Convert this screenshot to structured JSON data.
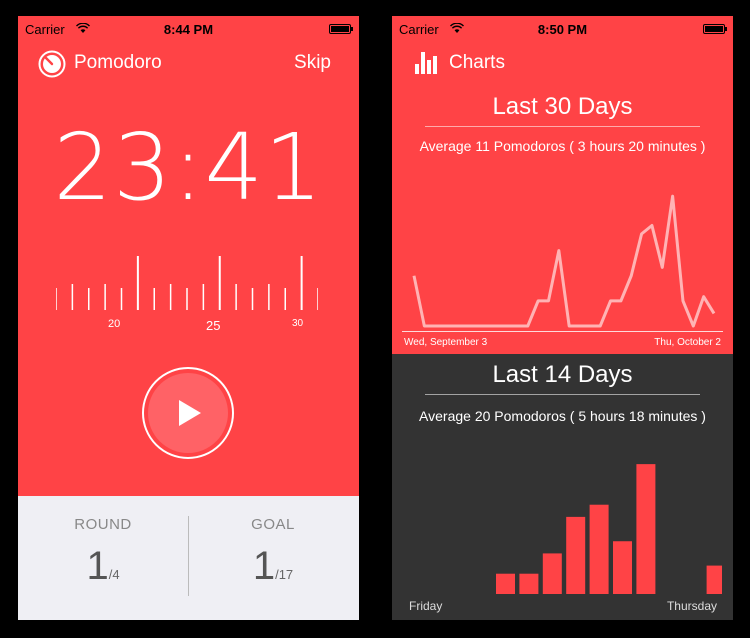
{
  "left": {
    "status": {
      "carrier": "Carrier",
      "time": "8:44 PM"
    },
    "nav": {
      "title": "Pomodoro",
      "skip_label": "Skip"
    },
    "timer": {
      "display": "23:41"
    },
    "ruler": {
      "labels": [
        "20",
        "25",
        "30"
      ],
      "ticks_visible": 17
    },
    "round": {
      "label": "ROUND",
      "value": "1",
      "total": "/4"
    },
    "goal": {
      "label": "GOAL",
      "value": "1",
      "total": "/17"
    },
    "colors": {
      "accent": "#ff4346",
      "bottom": "#efeff4"
    }
  },
  "right": {
    "status": {
      "carrier": "Carrier",
      "time": "8:50 PM"
    },
    "nav": {
      "title": "Charts"
    },
    "last30": {
      "title": "Last 30 Days",
      "subtitle": "Average 11 Pomodoros ( 3 hours 20 minutes )",
      "start_label": "Wed, September 3",
      "end_label": "Thu, October 2"
    },
    "last14": {
      "title": "Last 14 Days",
      "subtitle": "Average 20 Pomodoros ( 5 hours 18 minutes )",
      "start_label": "Friday",
      "end_label": "Thursday"
    },
    "colors": {
      "accent": "#ff4346",
      "dark": "#333333"
    }
  },
  "chart_data": [
    {
      "type": "line",
      "title": "Last 30 Days",
      "x": [
        1,
        2,
        3,
        4,
        5,
        6,
        7,
        8,
        9,
        10,
        11,
        12,
        13,
        14,
        15,
        16,
        17,
        18,
        19,
        20,
        21,
        22,
        23,
        24,
        25,
        26,
        27,
        28,
        29,
        30
      ],
      "series": [
        {
          "values": [
            12,
            0,
            0,
            0,
            0,
            0,
            0,
            0,
            0,
            0,
            0,
            0,
            6,
            6,
            18,
            0,
            0,
            0,
            0,
            6,
            6,
            12,
            22,
            24,
            14,
            31,
            6,
            0,
            7,
            3
          ]
        }
      ],
      "ylim": [
        0,
        32
      ]
    },
    {
      "type": "bar",
      "title": "Last 14 Days",
      "categories": [
        "1",
        "2",
        "3",
        "4",
        "5",
        "6",
        "7",
        "8",
        "9",
        "10",
        "11",
        "12",
        "13",
        "14"
      ],
      "values": [
        0,
        0,
        0,
        0,
        5,
        5,
        10,
        19,
        22,
        13,
        32,
        0,
        0,
        7
      ],
      "ylim": [
        0,
        34
      ]
    }
  ]
}
